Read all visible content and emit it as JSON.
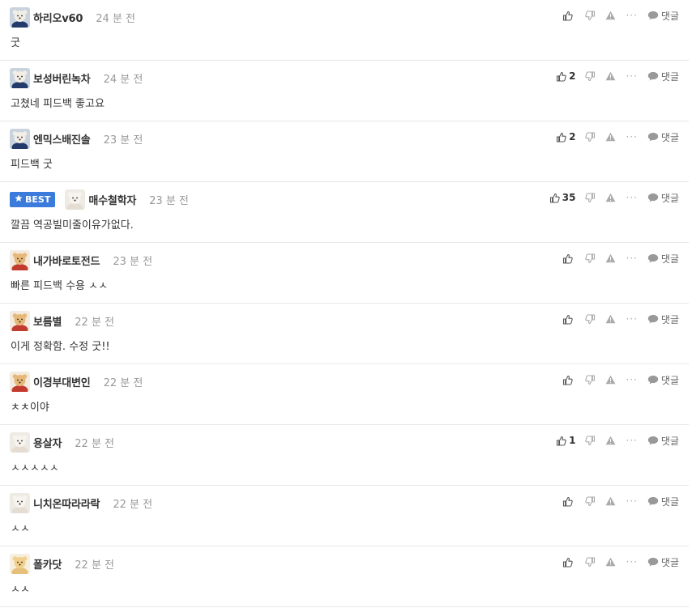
{
  "comments": [
    {
      "avatar": "blue-dog",
      "best": false,
      "name": "하리오v60",
      "time": "24 분 전",
      "text": "굿",
      "likes": ""
    },
    {
      "avatar": "blue-dog",
      "best": false,
      "name": "보성버린녹차",
      "time": "24 분 전",
      "text": "고쳤네 피드백 좋고요",
      "likes": "2"
    },
    {
      "avatar": "blue-dog",
      "best": false,
      "name": "엔믹스배진솔",
      "time": "23 분 전",
      "text": "피드백 굿",
      "likes": "2"
    },
    {
      "avatar": "white-dog",
      "best": true,
      "name": "매수철학자",
      "time": "23 분 전",
      "text": "깔끔 역공빌미줄이유가없다.",
      "likes": "35"
    },
    {
      "avatar": "red-dog",
      "best": false,
      "name": "내가바로토전드",
      "time": "23 분 전",
      "text": "빠른 피드백 수용 ㅅㅅ",
      "likes": ""
    },
    {
      "avatar": "red-dog",
      "best": false,
      "name": "보름별",
      "time": "22 분 전",
      "text": "이게 정확함. 수정 굿!!",
      "likes": ""
    },
    {
      "avatar": "red-dog",
      "best": false,
      "name": "이경부대변인",
      "time": "22 분 전",
      "text": "ㅊㅊ이야",
      "likes": ""
    },
    {
      "avatar": "white-dog",
      "best": false,
      "name": "용살자",
      "time": "22 분 전",
      "text": "ㅅㅅㅅㅅㅅ",
      "likes": "1"
    },
    {
      "avatar": "white-dog",
      "best": false,
      "name": "니치온따라라락",
      "time": "22 분 전",
      "text": "ㅅㅅ",
      "likes": ""
    },
    {
      "avatar": "yellow-dog",
      "best": false,
      "name": "폴카닷",
      "time": "22 분 전",
      "text": "ㅅㅅ",
      "likes": ""
    }
  ],
  "labels": {
    "best": "BEST",
    "reply": "댓글",
    "more": "···"
  },
  "icons": {
    "like": "thumbs-up-icon",
    "dislike": "thumbs-down-icon",
    "report": "warning-icon",
    "reply": "speech-bubble-icon",
    "best": "star-icon"
  },
  "colors": {
    "best_badge": "#3b7bdb",
    "time": "#999999",
    "divider": "#e8e8e8"
  }
}
